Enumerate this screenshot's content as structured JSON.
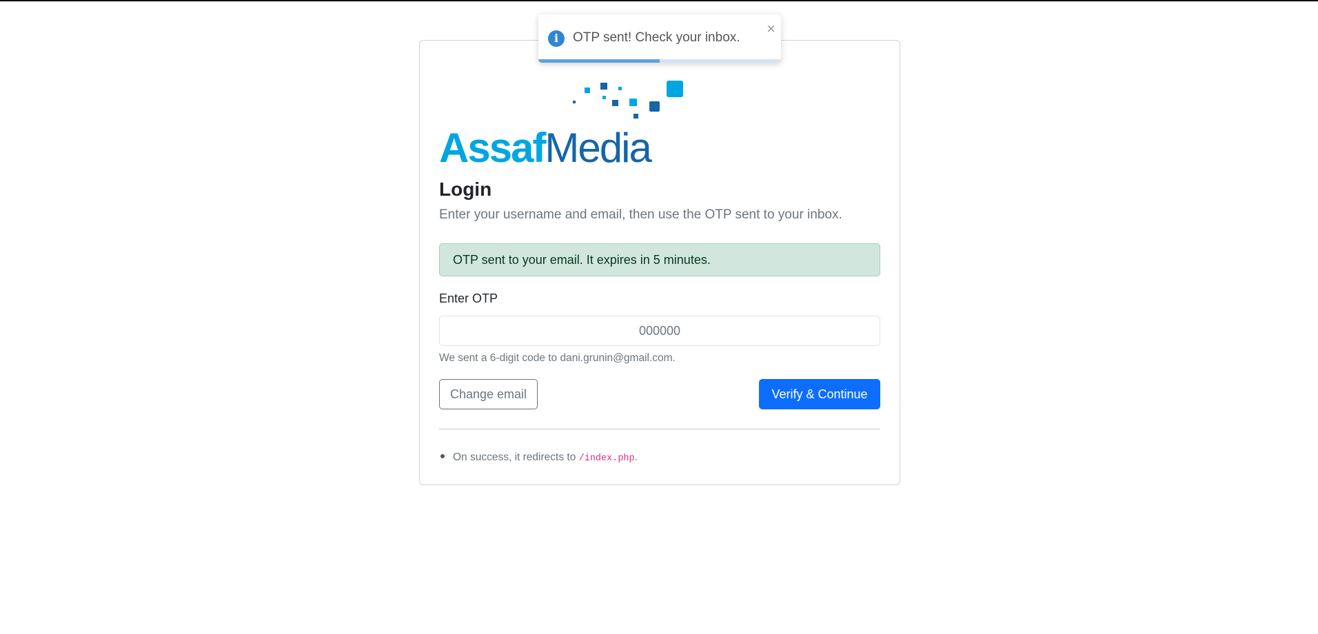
{
  "logo": {
    "text_part1": "Assaf",
    "text_part2": "Media",
    "icon": "assafmedia-logo"
  },
  "login": {
    "title": "Login",
    "subtitle": "Enter your username and email, then use the OTP sent to your inbox.",
    "alert": "OTP sent to your email. It expires in 5 minutes.",
    "otp_label": "Enter OTP",
    "otp_placeholder": "000000",
    "otp_value": "",
    "help_text": "We sent a 6-digit code to dani.grunin@gmail.com.",
    "change_email_label": "Change email",
    "verify_label": "Verify & Continue",
    "note_prefix": "On success, it redirects to ",
    "note_code": "/index.php",
    "note_suffix": "."
  },
  "toast": {
    "message": "OTP sent! Check your inbox.",
    "icon": "info-icon",
    "close_glyph": "×",
    "progress": 0.5
  },
  "colors": {
    "primary": "#0d6efd",
    "success_bg": "#d1e7dd",
    "logo_light": "#00a6e2",
    "logo_dark": "#1565a8",
    "toast_icon": "#3085d6"
  }
}
